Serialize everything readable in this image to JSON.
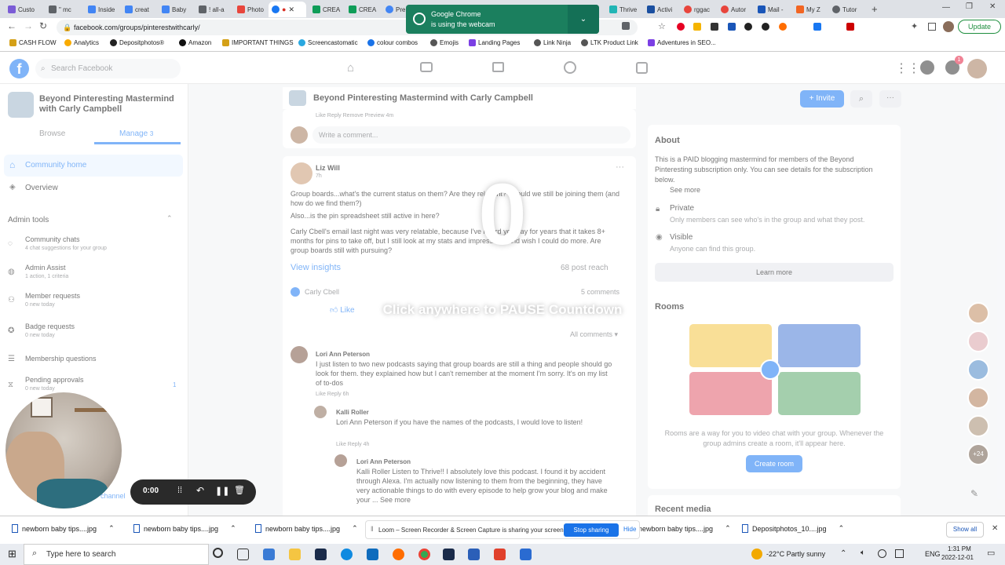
{
  "browser": {
    "tabs": [
      {
        "label": "Custo",
        "color": "#7b5cd6"
      },
      {
        "label": "\" mc",
        "color": "#5f6368"
      },
      {
        "label": "Inside",
        "color": "#4285f4"
      },
      {
        "label": "creat",
        "color": "#4285f4"
      },
      {
        "label": "Baby",
        "color": "#4285f4"
      },
      {
        "label": "! all-a",
        "color": "#5f6368"
      },
      {
        "label": "Photo",
        "color": "#e8453c"
      },
      {
        "label": "",
        "color": "#1877f2"
      },
      {
        "label": "CREA",
        "color": "#0f9d58"
      },
      {
        "label": "CREA",
        "color": "#0f9d58"
      },
      {
        "label": "Pre",
        "color": "#4285f4"
      },
      {
        "label": "Thrive",
        "color": "#21b5b5"
      },
      {
        "label": "Activi",
        "color": "#1a4fa0"
      },
      {
        "label": "rggac",
        "color": "#e8453c"
      },
      {
        "label": "Autor",
        "color": "#e8453c"
      },
      {
        "label": "Mail -",
        "color": "#1a56b8"
      },
      {
        "label": "My Z",
        "color": "#f26522"
      },
      {
        "label": "Tutor",
        "color": "#5f6368"
      }
    ],
    "url": "facebook.com/groups/pinterestwithcarly/",
    "update_label": "Update",
    "bookmarks": [
      "CASH FLOW",
      "Analytics",
      "Depositphotos®",
      "Amazon",
      "IMPORTANT THINGS",
      "Screencastomatic",
      "colour combos",
      "Emojis",
      "Landing Pages",
      "Link Ninja",
      "LTK Product Link",
      "Adventures in SEO..."
    ]
  },
  "notification": {
    "line1": "Google Chrome",
    "line2": "is using the webcam"
  },
  "facebook": {
    "search_placeholder": "Search Facebook",
    "group_name": "Beyond Pinteresting Mastermind with Carly Campbell",
    "group_name_line1": "Beyond Pinteresting Mastermind",
    "group_name_line2": "with Carly Campbell",
    "tabs": {
      "browse": "Browse",
      "manage": "Manage",
      "manage_count": "3"
    },
    "nav": {
      "community_home": "Community home",
      "overview": "Overview"
    },
    "admin_tools_label": "Admin tools",
    "admin_items": [
      {
        "label": "Community chats",
        "sub": "4 chat suggestions for your group"
      },
      {
        "label": "Admin Assist",
        "sub": "1 action, 1 criteria"
      },
      {
        "label": "Member requests",
        "sub": "0 new today"
      },
      {
        "label": "Badge requests",
        "sub": "0 new today"
      },
      {
        "label": "Membership questions",
        "sub": ""
      },
      {
        "label": "Pending approvals",
        "sub": "0 new today",
        "badge": "1"
      }
    ],
    "channel_fragment": "channel",
    "invite_label": "+ Invite",
    "feed": {
      "comment_actions": "Like   Reply   Remove Preview   4m",
      "write_comment": "Write a comment...",
      "post_author": "Liz Will",
      "post_time": "7h",
      "post_text_1": "Group boards...what's the current status on them? Are they relevant? Should we still be joining them (and how do we find them?)",
      "post_text_2": "Also...is the pin spreadsheet still active in here?",
      "post_text_3": "Carly Cbell's email last night was very relatable, because I've heard you say for years that it takes 8+ months for pins to take off, but I still look at my stats and impressions and wish I could do more. Are group boards still with pursuing?",
      "view_insights": "View insights",
      "post_reach": "68 post reach",
      "reactor": "Carly Cbell",
      "comments_count": "5 comments",
      "like_label": "Like",
      "all_comments": "All comments",
      "comments": [
        {
          "author": "Lori Ann Peterson",
          "text": "I just listen to two new podcasts saying that group boards are still a thing and people should go look for them. they explained how but I can't remember at the moment I'm sorry. It's on my list of to-dos",
          "meta": "Like   Reply   6h"
        },
        {
          "author": "Kalli Roller",
          "text": "Lori Ann Peterson if you have the names of the podcasts, I would love to listen!",
          "meta": "Like   Reply   4h"
        },
        {
          "author": "Lori Ann Peterson",
          "text": "Kalli Roller Listen to Thrive!! I absolutely love this podcast. I found it by accident through Alexa. I'm actually now listening to them from the beginning, they have very actionable things to do with every episode to help grow your blog and make your ... See more",
          "meta": ""
        }
      ]
    },
    "about": {
      "title": "About",
      "text": "This is a PAID blogging mastermind for members of the Beyond Pinteresting subscription only. You can see details for the subscription below.",
      "see_more": "See more",
      "private_title": "Private",
      "private_text": "Only members can see who's in the group and what they post.",
      "visible_title": "Visible",
      "visible_text": "Anyone can find this group.",
      "learn_more": "Learn more"
    },
    "rooms": {
      "title": "Rooms",
      "text": "Rooms are a way for you to video chat with your group. Whenever the group admins create a room, it'll appear here.",
      "create_label": "Create room"
    },
    "recent_media": "Recent media",
    "contacts_extra": "+24"
  },
  "countdown": {
    "value": "0",
    "message": "Click anywhere to PAUSE Countdown"
  },
  "loom": {
    "timer": "0:00",
    "share_text": "Loom – Screen Recorder & Screen Capture is sharing your screen.",
    "stop_label": "Stop sharing",
    "hide_label": "Hide"
  },
  "downloads": {
    "items": [
      "newborn baby tips....jpg",
      "newborn baby tips....jpg",
      "newborn baby tips....jpg",
      "newborn baby tips....jpg",
      "Depositphotos_10....jpg"
    ],
    "show_all": "Show all"
  },
  "taskbar": {
    "search_placeholder": "Type here to search",
    "weather": "-22°C  Partly sunny",
    "lang": "ENG",
    "time": "1:31 PM",
    "date": "2022-12-01"
  }
}
